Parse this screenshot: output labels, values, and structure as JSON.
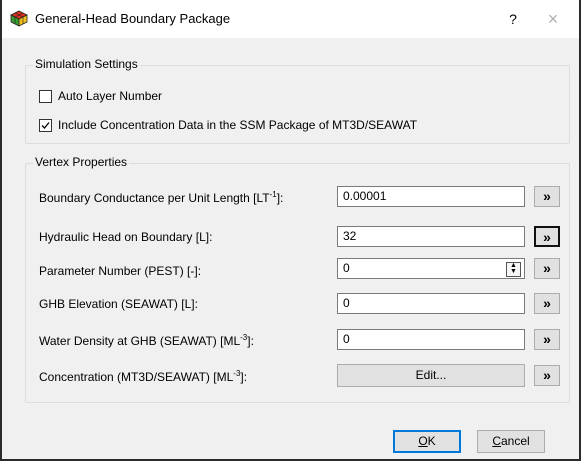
{
  "window": {
    "title": "General-Head Boundary Package",
    "help": "?",
    "close": "×"
  },
  "simulation": {
    "group_title": "Simulation Settings",
    "auto_layer": {
      "label": "Auto Layer Number",
      "checked": false
    },
    "include_conc": {
      "label": "Include Concentration Data in the SSM Package of MT3D/SEAWAT",
      "checked": true
    }
  },
  "vertex": {
    "group_title": "Vertex Properties",
    "rows": [
      {
        "label_pre": "Boundary Conductance per Unit Length [LT",
        "label_sup": "-1",
        "label_post": "]:",
        "value": "0.00001"
      },
      {
        "label_pre": "Hydraulic Head on Boundary [L]:",
        "value": "32"
      },
      {
        "label_pre": "Parameter Number (PEST) [-]:",
        "value": "0"
      },
      {
        "label_pre": "GHB Elevation (SEAWAT) [L]:",
        "value": "0"
      },
      {
        "label_pre": "Water Density at GHB (SEAWAT) [ML",
        "label_sup": "-3",
        "label_post": "]:",
        "value": "0"
      },
      {
        "label_pre": "Concentration (MT3D/SEAWAT) [ML",
        "label_sup": "-3",
        "label_post": "]:",
        "button": "Edit..."
      }
    ],
    "arrow_glyph": "»"
  },
  "buttons": {
    "ok_mnemonic": "O",
    "ok_rest": "K",
    "cancel_mnemonic": "C",
    "cancel_rest": "ancel"
  }
}
